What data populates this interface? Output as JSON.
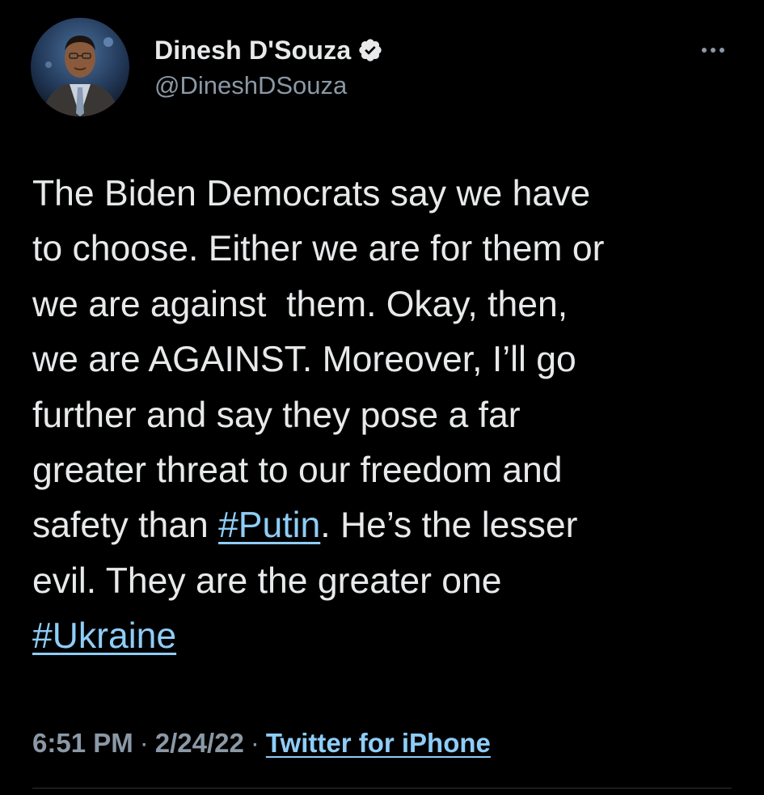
{
  "author": {
    "name": "Dinesh D'Souza",
    "handle": "@DineshDSouza",
    "verified": true,
    "avatar_icon": "profile-photo-avatar"
  },
  "tweet": {
    "lines": [
      [
        {
          "text": "The Biden Democrats say we have"
        }
      ],
      [
        {
          "text": "to choose. Either we are for them or"
        }
      ],
      [
        {
          "text": "we are against  them. Okay, then,"
        }
      ],
      [
        {
          "text": "we are AGAINST. Moreover, I’ll go"
        }
      ],
      [
        {
          "text": "further and say they pose a far"
        }
      ],
      [
        {
          "text": "greater threat to our freedom and"
        }
      ],
      [
        {
          "text": "safety than "
        },
        {
          "text": "#Putin",
          "hashtag": true
        },
        {
          "text": ". He’s the lesser"
        }
      ],
      [
        {
          "text": "evil. They are the greater one"
        }
      ],
      [
        {
          "text": "#Ukraine",
          "hashtag": true
        }
      ]
    ]
  },
  "meta": {
    "time": "6:51 PM",
    "separator": "·",
    "date": "2/24/22",
    "source": "Twitter for iPhone"
  },
  "icons": {
    "verified": "verified-badge-icon",
    "more": "more-options-icon"
  },
  "colors": {
    "background": "#000000",
    "text": "#e7e9ea",
    "secondary": "#8b98a5",
    "link": "#8ecdf8"
  }
}
